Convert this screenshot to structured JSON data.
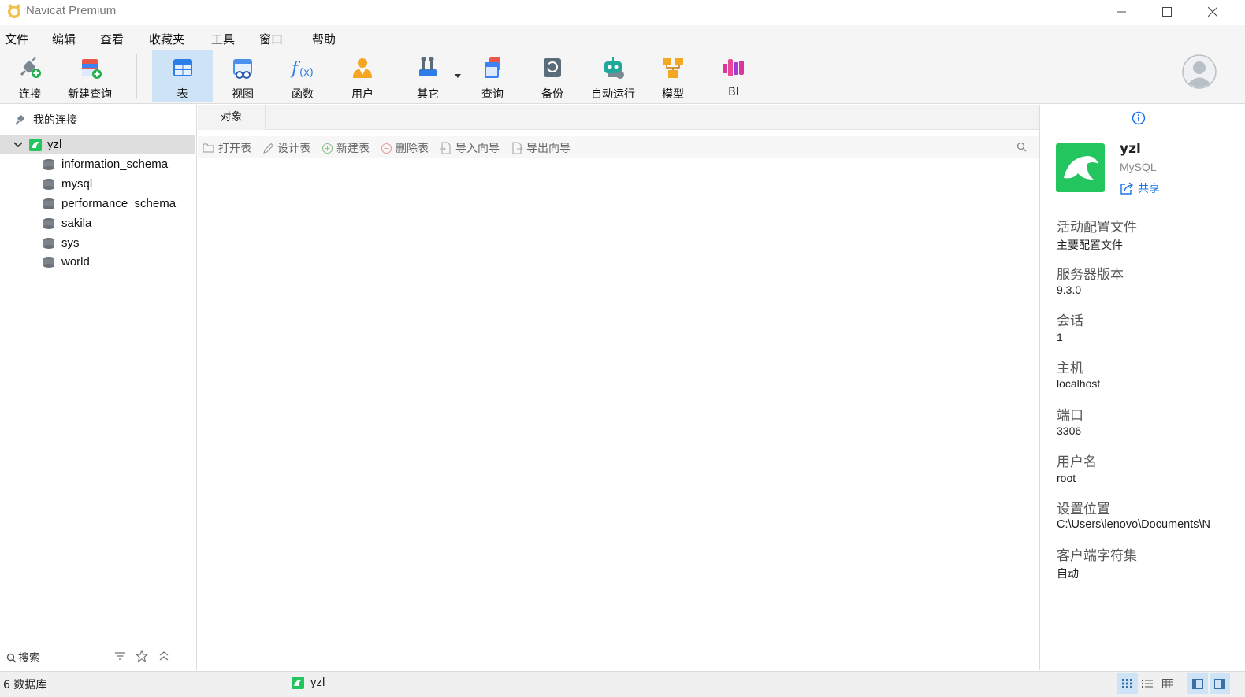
{
  "window": {
    "title": "Navicat Premium"
  },
  "menu": [
    "文件",
    "编辑",
    "查看",
    "收藏夹",
    "工具",
    "窗口",
    "帮助"
  ],
  "toolbar": {
    "connect": "连接",
    "new_query": "新建查询",
    "table": "表",
    "view": "视图",
    "function": "函数",
    "user": "用户",
    "other": "其它",
    "query": "查询",
    "backup": "备份",
    "automation": "自动运行",
    "model": "模型",
    "bi": "BI"
  },
  "sidebar": {
    "header": "我的连接",
    "connection": "yzl",
    "databases": [
      "information_schema",
      "mysql",
      "performance_schema",
      "sakila",
      "sys",
      "world"
    ],
    "search_placeholder": "搜索"
  },
  "main": {
    "tab": "对象",
    "actions": [
      "打开表",
      "设计表",
      "新建表",
      "删除表",
      "导入向导",
      "导出向导"
    ]
  },
  "details": {
    "name": "yzl",
    "type": "MySQL",
    "share": "共享",
    "props": [
      {
        "label": "活动配置文件",
        "value": "主要配置文件"
      },
      {
        "label": "服务器版本",
        "value": "9.3.0"
      },
      {
        "label": "会话",
        "value": "1"
      },
      {
        "label": "主机",
        "value": "localhost"
      },
      {
        "label": "端口",
        "value": "3306"
      },
      {
        "label": "用户名",
        "value": "root"
      },
      {
        "label": "设置位置",
        "value": "C:\\Users\\lenovo\\Documents\\N"
      },
      {
        "label": "客户端字符集",
        "value": "自动"
      }
    ]
  },
  "status": {
    "left": "6 数据库",
    "connection": "yzl"
  },
  "colors": {
    "accent": "#cfe3f7",
    "mysql_green": "#22c55e",
    "link": "#1a73e8"
  }
}
